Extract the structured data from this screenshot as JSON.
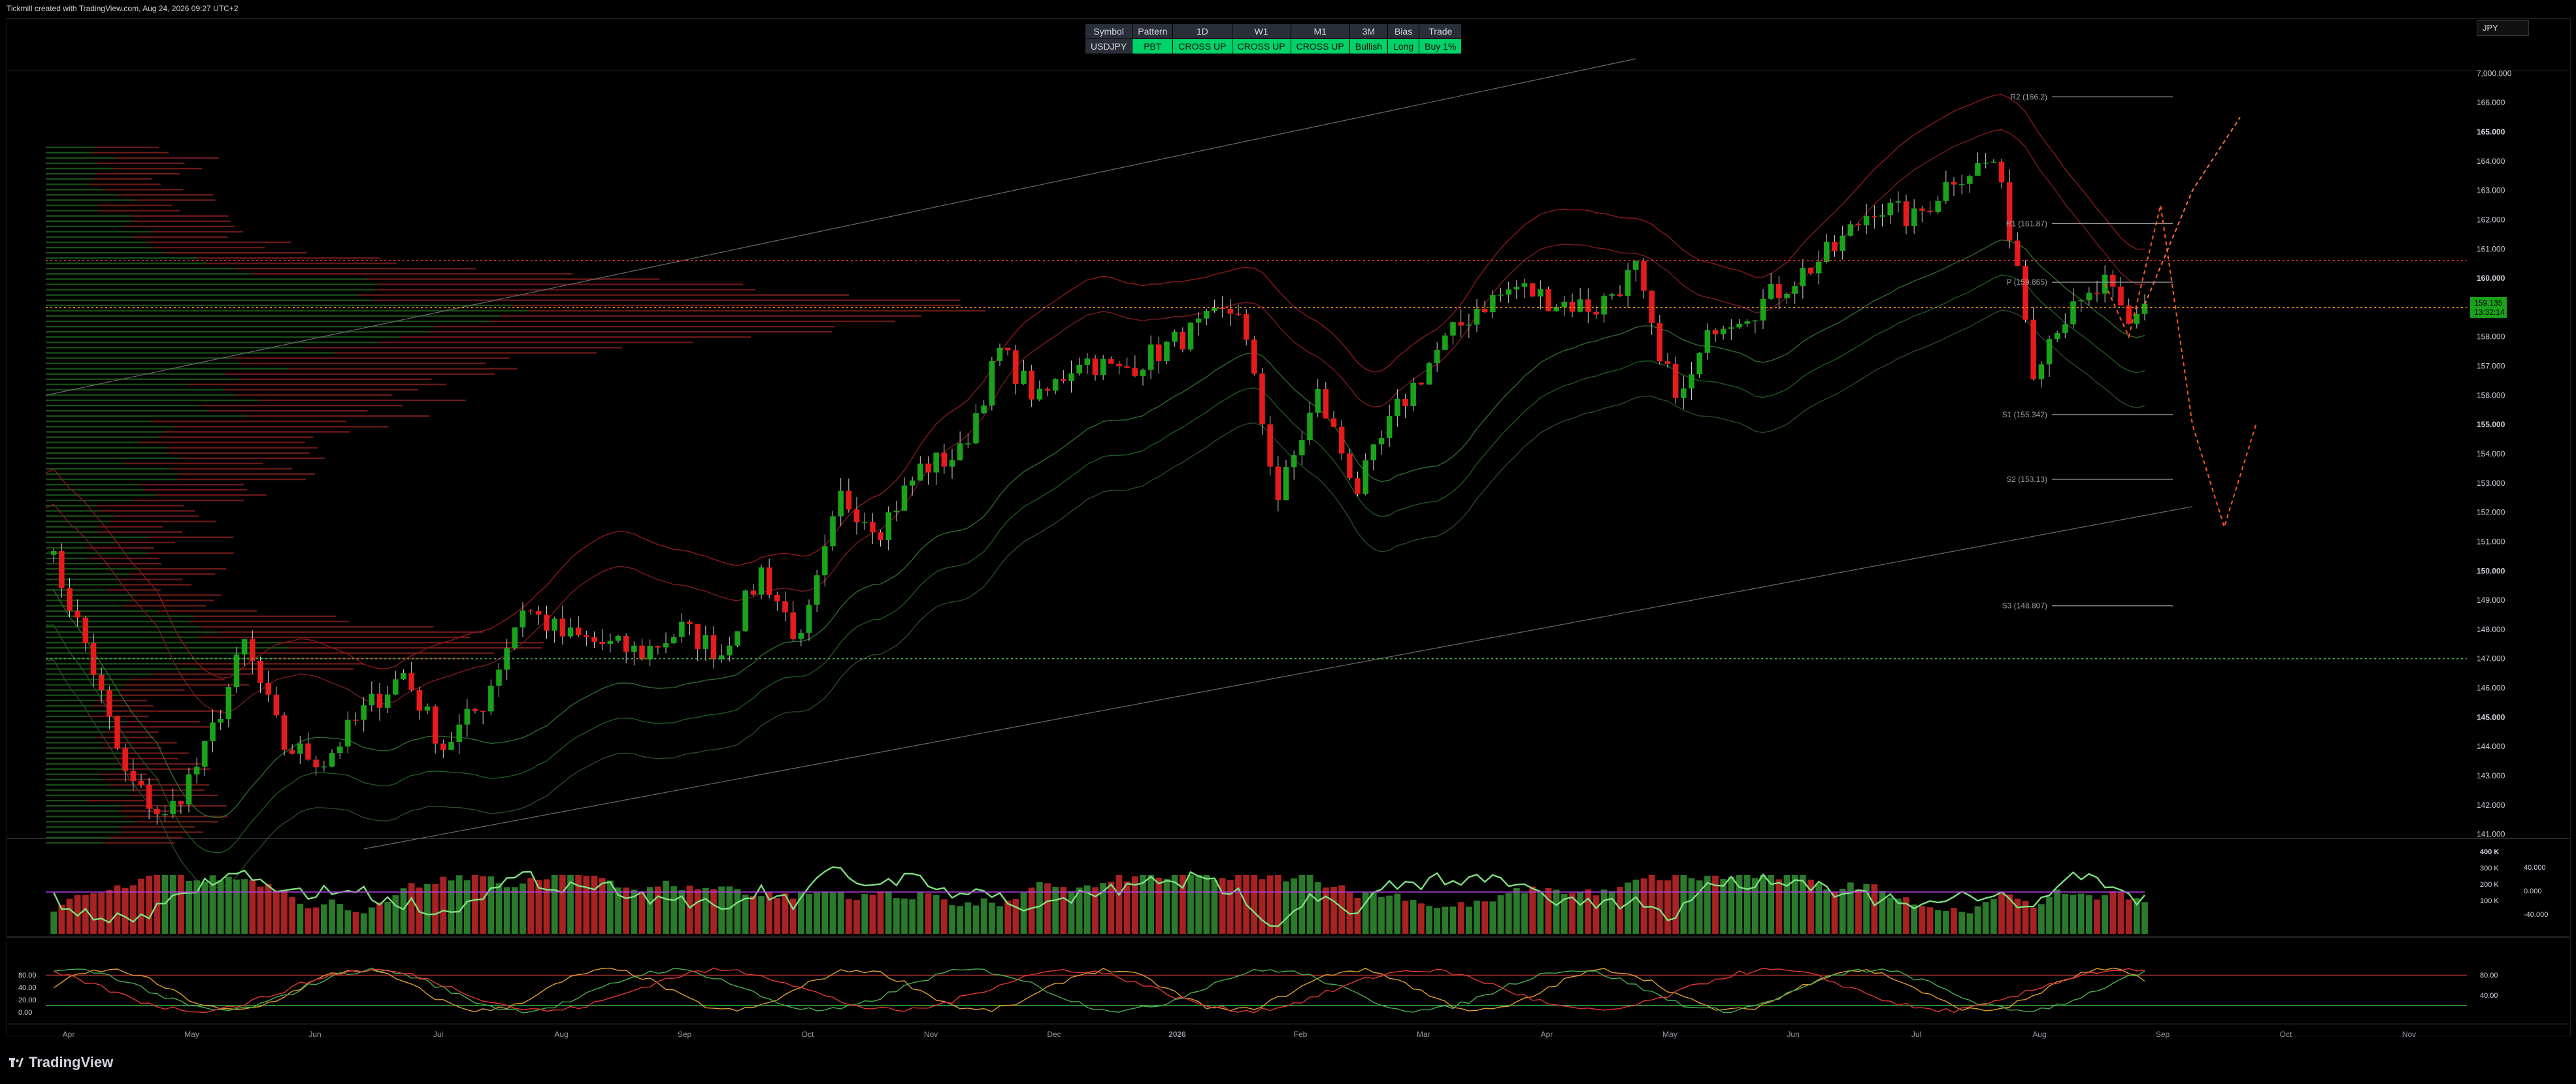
{
  "caption": "Tickmill created with TradingView.com, Aug 24, 2026 09:27 UTC+2",
  "brand": "TradingView",
  "symbol_box": "JPY",
  "signal_table": {
    "headers": [
      "Symbol",
      "Pattern",
      "1D",
      "W1",
      "M1",
      "3M",
      "Bias",
      "Trade"
    ],
    "row": [
      "USDJPY",
      "PBT",
      "CROSS UP",
      "CROSS UP",
      "CROSS UP",
      "Bullish",
      "Long",
      "Buy 1%"
    ]
  },
  "colors": {
    "up": "#089981",
    "down": "#f23645",
    "green_bright": "#00d26a",
    "bg": "#000000"
  },
  "chart_data": [
    {
      "type": "line",
      "name": "USDJPY daily candles",
      "y_ticks": [
        {
          "v": 141,
          "label": "141.000",
          "bold": false
        },
        {
          "v": 142,
          "label": "142.000",
          "bold": false
        },
        {
          "v": 143,
          "label": "143.000",
          "bold": false
        },
        {
          "v": 144,
          "label": "144.000",
          "bold": false
        },
        {
          "v": 145,
          "label": "145.000",
          "bold": true
        },
        {
          "v": 146,
          "label": "146.000",
          "bold": false
        },
        {
          "v": 147,
          "label": "147.000",
          "bold": false
        },
        {
          "v": 148,
          "label": "148.000",
          "bold": false
        },
        {
          "v": 149,
          "label": "149.000",
          "bold": false
        },
        {
          "v": 150,
          "label": "150.000",
          "bold": true
        },
        {
          "v": 151,
          "label": "151.000",
          "bold": false
        },
        {
          "v": 152,
          "label": "152.000",
          "bold": false
        },
        {
          "v": 153,
          "label": "153.000",
          "bold": false
        },
        {
          "v": 154,
          "label": "154.000",
          "bold": false
        },
        {
          "v": 155,
          "label": "155.000",
          "bold": true
        },
        {
          "v": 156,
          "label": "156.000",
          "bold": false
        },
        {
          "v": 157,
          "label": "157.000",
          "bold": false
        },
        {
          "v": 158,
          "label": "158.000",
          "bold": false
        },
        {
          "v": 159,
          "label": "159.000",
          "bold": false
        },
        {
          "v": 160,
          "label": "160.000",
          "bold": true
        },
        {
          "v": 161,
          "label": "161.000",
          "bold": false
        },
        {
          "v": 162,
          "label": "162.000",
          "bold": false
        },
        {
          "v": 163,
          "label": "163.000",
          "bold": false
        },
        {
          "v": 164,
          "label": "164.000",
          "bold": false
        },
        {
          "v": 165,
          "label": "165.000",
          "bold": true
        },
        {
          "v": 166,
          "label": "166.000",
          "bold": false
        },
        {
          "v": 167,
          "label": "7,000.000",
          "bold": false
        }
      ],
      "ylim": [
        140.5,
        167.5
      ],
      "x_months": [
        "Apr",
        "May",
        "Jun",
        "Jul",
        "Aug",
        "Sep",
        "Oct",
        "Nov",
        "Dec",
        "2026",
        "Feb",
        "Mar",
        "Apr",
        "May",
        "Jun",
        "Jul",
        "Aug",
        "Sep",
        "Oct",
        "Nov"
      ],
      "price_path": [
        [
          0,
          151.0
        ],
        [
          5,
          147.5
        ],
        [
          10,
          143.0
        ],
        [
          15,
          141.5
        ],
        [
          20,
          143.8
        ],
        [
          25,
          147.5
        ],
        [
          30,
          144.0
        ],
        [
          35,
          143.5
        ],
        [
          40,
          145.2
        ],
        [
          45,
          146.5
        ],
        [
          50,
          144.0
        ],
        [
          55,
          145.5
        ],
        [
          60,
          148.8
        ],
        [
          65,
          147.8
        ],
        [
          70,
          147.5
        ],
        [
          75,
          147.2
        ],
        [
          80,
          148.0
        ],
        [
          85,
          147.2
        ],
        [
          90,
          150.0
        ],
        [
          95,
          147.5
        ],
        [
          100,
          152.5
        ],
        [
          105,
          151.5
        ],
        [
          110,
          153.5
        ],
        [
          115,
          154.0
        ],
        [
          120,
          157.5
        ],
        [
          125,
          155.8
        ],
        [
          130,
          157.3
        ],
        [
          135,
          156.8
        ],
        [
          140,
          157.5
        ],
        [
          145,
          158.3
        ],
        [
          150,
          159.0
        ],
        [
          155,
          152.5
        ],
        [
          160,
          156.0
        ],
        [
          165,
          152.8
        ],
        [
          170,
          155.5
        ],
        [
          175,
          157.5
        ],
        [
          180,
          159.0
        ],
        [
          185,
          159.7
        ],
        [
          190,
          159.2
        ],
        [
          195,
          159.0
        ],
        [
          200,
          160.3
        ],
        [
          203,
          157.0
        ],
        [
          206,
          156.0
        ],
        [
          210,
          158.5
        ],
        [
          215,
          159.0
        ],
        [
          220,
          160.0
        ],
        [
          225,
          161.0
        ],
        [
          230,
          162.5
        ],
        [
          235,
          162.0
        ],
        [
          240,
          163.5
        ],
        [
          245,
          164.0
        ],
        [
          248,
          160.5
        ],
        [
          250,
          157.0
        ],
        [
          253,
          158.5
        ],
        [
          256,
          159.0
        ],
        [
          259,
          159.8
        ],
        [
          262,
          158.3
        ],
        [
          264,
          159.135
        ]
      ],
      "last_price": {
        "value": "159.135",
        "countdown": "13:32:14"
      },
      "pivots": [
        {
          "label": "R2 (166.2)",
          "value": 166.2
        },
        {
          "label": "R1 (161.87)",
          "value": 161.87
        },
        {
          "label": "P (159.865)",
          "value": 159.865
        },
        {
          "label": "S1 (155.342)",
          "value": 155.342
        },
        {
          "label": "S2 (153.13)",
          "value": 153.13
        },
        {
          "label": "S3 (148.807)",
          "value": 148.807
        }
      ],
      "dotted_levels": [
        {
          "value": 160.6,
          "color": "#f23645"
        },
        {
          "value": 159.0,
          "color": "#ff9800"
        },
        {
          "value": 147.0,
          "color": "#4caf50"
        }
      ],
      "channel": {
        "upper": [
          [
            0,
            156.0
          ],
          [
            200,
            167.5
          ]
        ],
        "lower": [
          [
            40,
            140.5
          ],
          [
            270,
            152.2
          ]
        ]
      },
      "projection": [
        [
          259,
          159.8
        ],
        [
          262,
          158.0
        ],
        [
          266,
          162.5
        ],
        [
          270,
          155.0
        ],
        [
          274,
          151.5
        ],
        [
          278,
          155.0
        ]
      ],
      "projection_up": [
        [
          264,
          159.1
        ],
        [
          270,
          163.0
        ],
        [
          276,
          165.5
        ]
      ]
    },
    {
      "type": "bar",
      "name": "Volume",
      "y_ticks": [
        "400 K",
        "300 K",
        "200 K",
        "100 K"
      ],
      "osc_ticks": [
        "40.000",
        "0.000",
        "-40.000"
      ]
    },
    {
      "type": "line",
      "name": "Stochastic",
      "y_ticks": [
        "80.00",
        "40.00",
        "20.00",
        "0.00"
      ],
      "right_ticks": [
        "80.00",
        "40.00"
      ],
      "levels": [
        80,
        20
      ]
    }
  ]
}
